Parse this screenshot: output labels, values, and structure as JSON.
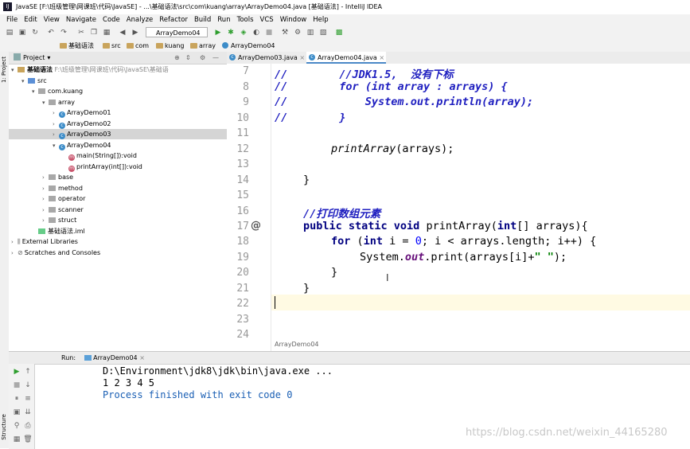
{
  "window": {
    "title": "JavaSE [F:\\班级管理\\网课班\\代码\\JavaSE] - ...\\基础语法\\src\\com\\kuang\\array\\ArrayDemo04.java [基础语法] - IntelliJ IDEA"
  },
  "menu": [
    "File",
    "Edit",
    "View",
    "Navigate",
    "Code",
    "Analyze",
    "Refactor",
    "Build",
    "Run",
    "Tools",
    "VCS",
    "Window",
    "Help"
  ],
  "toolbar": {
    "run_config": "ArrayDemo04"
  },
  "breadcrumbs": [
    "基础语法",
    "src",
    "com",
    "kuang",
    "array",
    "ArrayDemo04"
  ],
  "left_strip": {
    "project_label": "1: Project",
    "structure_label": "Structure"
  },
  "project": {
    "header": "Project",
    "root_label": "基础语法",
    "root_path": "F:\\班级管理\\网课班\\代码\\JavaSE\\基础语",
    "src": "src",
    "package": "com.kuang",
    "array_folder": "array",
    "classes": [
      "ArrayDemo01",
      "ArrayDemo02",
      "ArrayDemo03",
      "ArrayDemo04"
    ],
    "methods": [
      "main(String[]):void",
      "printArray(int[]):void"
    ],
    "folders": [
      "base",
      "method",
      "operator",
      "scanner",
      "struct"
    ],
    "iml": "基础语法.iml",
    "external": "External Libraries",
    "scratches": "Scratches and Consoles"
  },
  "tabs": [
    "ArrayDemo03.java",
    "ArrayDemo04.java"
  ],
  "editor": {
    "line_numbers": [
      "7",
      "8",
      "9",
      "10",
      "11",
      "12",
      "13",
      "14",
      "15",
      "16",
      "17",
      "18",
      "19",
      "20",
      "21",
      "22",
      "23",
      "24"
    ],
    "override_marker": "@",
    "lines": {
      "l7_cm": "//",
      "l7_text": "        //JDK1.5,  没有下标",
      "l8_cm": "//",
      "l8_kw": "for",
      "l8_text": " (int array : arrays) {",
      "l9_cm": "//",
      "l9_text": "            System.out.println(array);",
      "l10_cm": "//",
      "l10_text": "        }",
      "l12_call": "printArray",
      "l12_rest": "(arrays);",
      "l14": "}",
      "l16": "//打印数组元素",
      "l17_kw": "public static void",
      "l17_rest": " printArray(",
      "l17_kw2": "int",
      "l17_rest2": "[] arrays){",
      "l18_kw": "for",
      "l18_a": " (",
      "l18_kw2": "int",
      "l18_b": " i = ",
      "l18_num": "0",
      "l18_c": "; i < arrays.length; i++) {",
      "l19_a": "System.",
      "l19_out": "out",
      "l19_b": ".print(arrays[i]+",
      "l19_str": "\" \"",
      "l19_c": ");",
      "l20": "}",
      "l21": "}"
    },
    "status_crumb": "ArrayDemo04"
  },
  "run": {
    "label": "Run:",
    "tab": "ArrayDemo04",
    "cmd": "D:\\Environment\\jdk8\\jdk\\bin\\java.exe ...",
    "output": "1 2 3 4 5",
    "finished": "Process finished with exit code 0"
  },
  "watermark": "https://blog.csdn.net/weixin_44165280"
}
